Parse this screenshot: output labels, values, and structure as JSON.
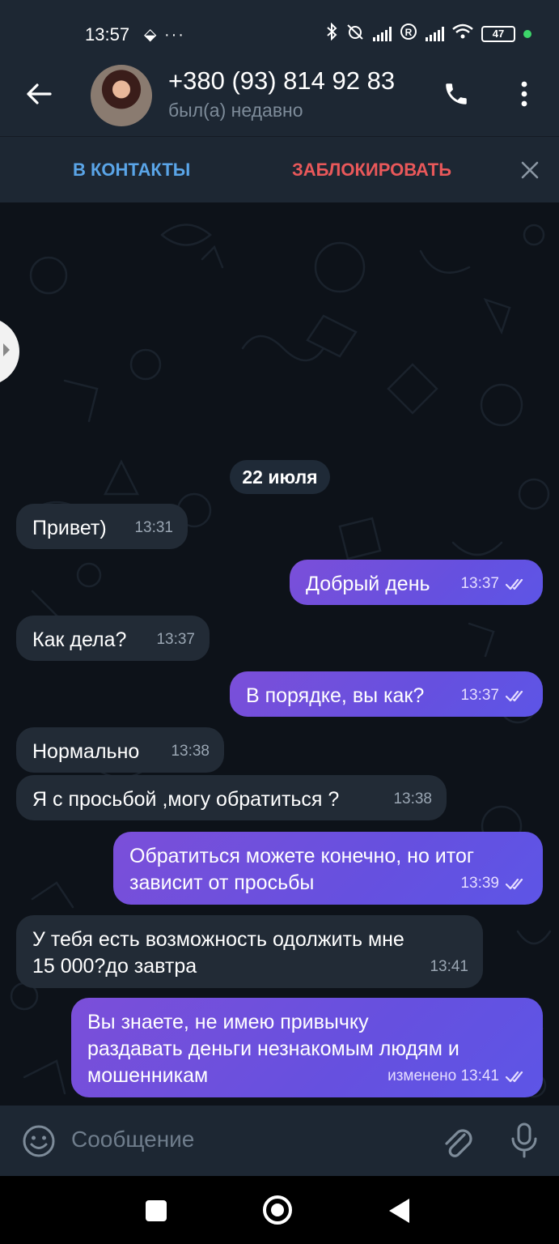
{
  "status_bar": {
    "time": "13:57",
    "left_icons": "⬙ ···",
    "battery": "47"
  },
  "header": {
    "contact_name": "+380 (93) 814 92 83",
    "last_seen": "был(а) недавно"
  },
  "action_bar": {
    "add_contact": "В КОНТАКТЫ",
    "block": "ЗАБЛОКИРОВАТЬ"
  },
  "chat": {
    "date": "22 июля",
    "messages": [
      {
        "direction": "in",
        "lines": [
          "Привет)"
        ],
        "time": "13:31"
      },
      {
        "direction": "out",
        "lines": [
          "Добрый день"
        ],
        "time": "13:37",
        "read": true
      },
      {
        "direction": "in",
        "lines": [
          "Как дела?"
        ],
        "time": "13:37"
      },
      {
        "direction": "out",
        "lines": [
          "В порядке, вы как?"
        ],
        "time": "13:37",
        "read": true
      },
      {
        "direction": "in",
        "lines": [
          "Нормально"
        ],
        "time": "13:38"
      },
      {
        "direction": "in",
        "lines": [
          "Я с просьбой ,могу обратиться ?"
        ],
        "time": "13:38"
      },
      {
        "direction": "out",
        "lines": [
          "Обратиться можете конечно, но итог",
          "зависит от просьбы"
        ],
        "time": "13:39",
        "read": true
      },
      {
        "direction": "in",
        "lines": [
          "У тебя есть возможность одолжить мне",
          "15 000?до завтра"
        ],
        "time": "13:41"
      },
      {
        "direction": "out",
        "lines": [
          "Вы знаете, не имею привычку",
          "раздавать деньги незнакомым людям и",
          "мошенникам"
        ],
        "time": "изменено 13:41",
        "read": true
      }
    ]
  },
  "composer": {
    "placeholder": "Сообщение"
  },
  "colors": {
    "header_bg": "#1d2733",
    "chat_bg": "#0d1219",
    "incoming_bubble": "#222b36",
    "outgoing_bubble": "#6650df",
    "accent_blue": "#5aa5e8",
    "danger_red": "#e9585a"
  },
  "icons": {
    "back": "arrow-left-icon",
    "call": "phone-icon",
    "menu": "more-vertical-icon",
    "close": "close-icon",
    "emoji": "smile-icon",
    "attach": "paperclip-icon",
    "mic": "microphone-icon"
  }
}
